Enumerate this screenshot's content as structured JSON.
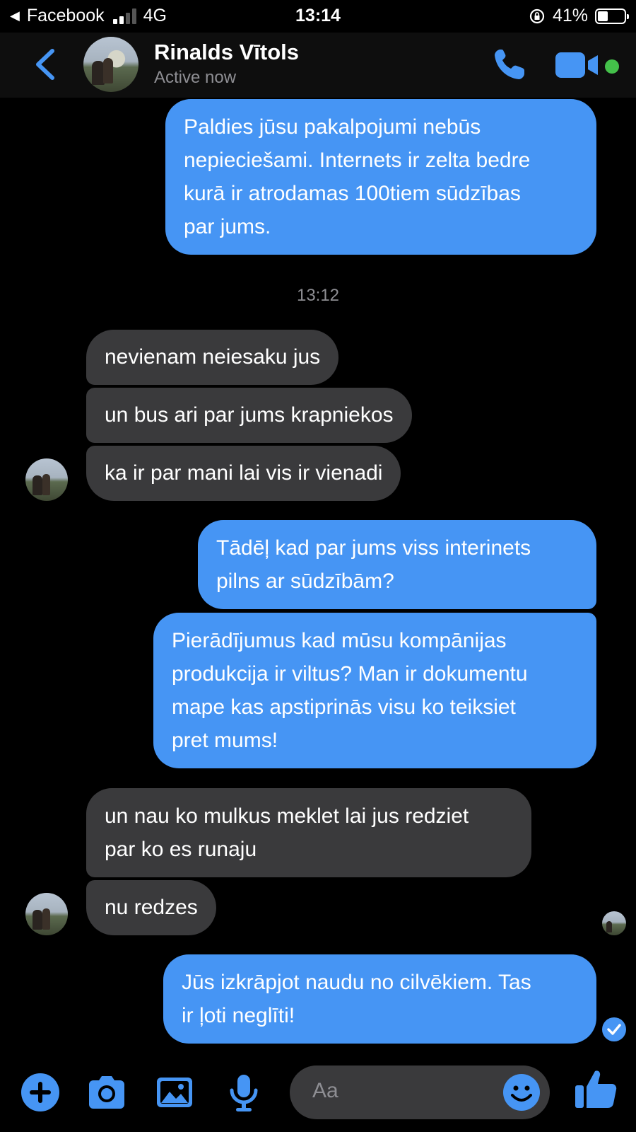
{
  "status_bar": {
    "app": "Facebook",
    "network": "4G",
    "time": "13:14",
    "battery": "41%"
  },
  "header": {
    "contact_name": "Rinalds Vītols",
    "status": "Active now"
  },
  "messages": [
    {
      "dir": "out",
      "lines": [
        "Paldies jūsu pakalpojumi nebūs",
        "nepieciešami. Internets ir zelta bedre",
        "kurā ir atrodamas 100tiem sūdzības",
        "par jums."
      ]
    },
    {
      "dir": "time",
      "text": "13:12"
    },
    {
      "dir": "in",
      "lines": [
        "nevienam neiesaku jus"
      ]
    },
    {
      "dir": "in",
      "lines": [
        "un bus ari par jums krapniekos"
      ]
    },
    {
      "dir": "in",
      "lines": [
        "ka ir par mani lai vis ir vienadi"
      ]
    },
    {
      "dir": "out",
      "lines": [
        "Tādēļ kad par jums viss  interinets",
        "pilns ar sūdzībām?"
      ]
    },
    {
      "dir": "out",
      "lines": [
        "Pierādījumus kad mūsu kompānijas",
        "produkcija ir viltus? Man ir dokumentu",
        "mape kas apstiprinās visu ko teiksiet",
        "pret mums!"
      ]
    },
    {
      "dir": "in",
      "lines": [
        "un nau ko mulkus meklet lai jus redziet",
        "par ko es runaju"
      ]
    },
    {
      "dir": "in",
      "lines": [
        "nu redzes"
      ]
    },
    {
      "dir": "out",
      "lines": [
        "Jūs izkrāpjot naudu no cilvēkiem. Tas",
        "ir ļoti neglīti!"
      ]
    }
  ],
  "composer": {
    "placeholder": "Aa"
  },
  "colors": {
    "accent": "#4695f4",
    "incoming_bubble": "#3a3a3c",
    "online": "#44c04a"
  }
}
